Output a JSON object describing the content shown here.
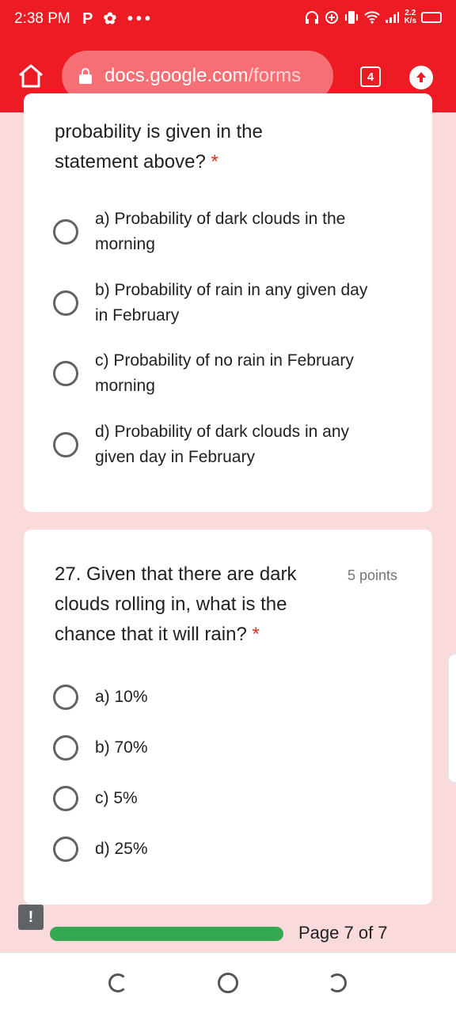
{
  "status_bar": {
    "time": "2:38 PM",
    "left_icons": "P ✿ •••",
    "network_speed_value": "2.2",
    "network_speed_unit": "K/s",
    "icons": [
      "headphones-icon",
      "data-saver-icon",
      "vibrate-icon",
      "wifi-icon",
      "signal-icon",
      "battery-icon"
    ]
  },
  "browser": {
    "url_domain": "docs.google.com",
    "url_path": "/forms",
    "tab_count": "4"
  },
  "question_26": {
    "text_partial": "probability is given in the statement above?",
    "required_mark": "*",
    "options": [
      "a) Probability of dark clouds in the morning",
      "b) Probability of rain in any given day in February",
      "c) Probability of no rain in February morning",
      "d) Probability of dark clouds in any given day in February"
    ]
  },
  "question_27": {
    "text": "27. Given that there are dark clouds rolling in, what is the chance that it will rain?",
    "required_mark": "*",
    "points": "5 points",
    "options": [
      "a) 10%",
      "b) 70%",
      "c) 5%",
      "d) 25%"
    ]
  },
  "footer": {
    "report_icon_glyph": "!",
    "page_label": "Page 7 of 7",
    "progress_fraction": 1.0
  },
  "colors": {
    "brand_red": "#ed1c24",
    "background_pink": "#fbdadb",
    "progress_green": "#34a853",
    "required_red": "#d93025"
  }
}
